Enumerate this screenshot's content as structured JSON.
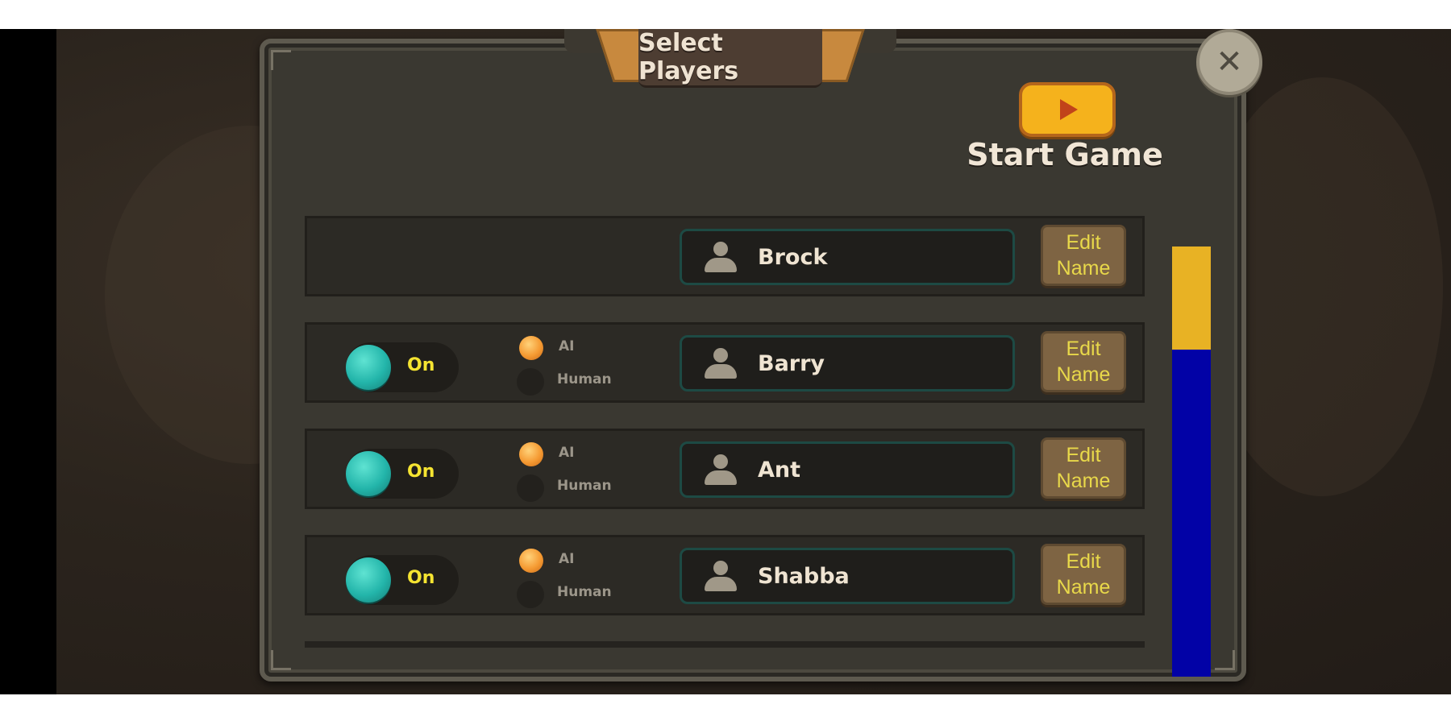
{
  "dialog": {
    "title": "Select Players",
    "close_glyph": "✕",
    "start_label": "Start Game"
  },
  "players": [
    {
      "name": "Brock",
      "edit_line1": "Edit",
      "edit_line2": "Name",
      "has_controls": false
    },
    {
      "name": "Barry",
      "toggle": "On",
      "ai_label": "AI",
      "human_label": "Human",
      "edit_line1": "Edit",
      "edit_line2": "Name",
      "has_controls": true
    },
    {
      "name": "Ant",
      "toggle": "On",
      "ai_label": "AI",
      "human_label": "Human",
      "edit_line1": "Edit",
      "edit_line2": "Name",
      "has_controls": true
    },
    {
      "name": "Shabba",
      "toggle": "On",
      "ai_label": "AI",
      "human_label": "Human",
      "edit_line1": "Edit",
      "edit_line2": "Name",
      "has_controls": true
    }
  ],
  "scrollbar": {
    "thumb_color": "#e8b224",
    "track_color": "#0202a6",
    "thumb_fraction": 0.24,
    "position_fraction": 0.0
  },
  "colors": {
    "accent_teal": "#23b5aa",
    "accent_orange": "#f59a32",
    "label_yellow": "#e8d84a"
  },
  "icons": [
    "close-icon",
    "play-icon",
    "person-icon"
  ]
}
